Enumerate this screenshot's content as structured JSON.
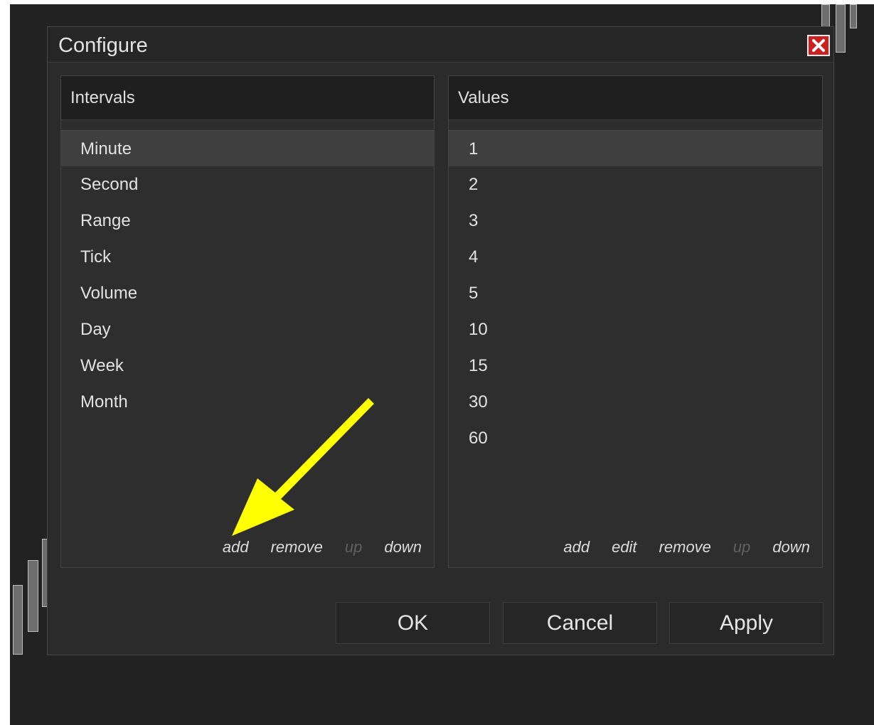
{
  "dialog": {
    "title": "Configure",
    "close_icon": "close-icon"
  },
  "intervals": {
    "header": "Intervals",
    "items": [
      "Minute",
      "Second",
      "Range",
      "Tick",
      "Volume",
      "Day",
      "Week",
      "Month"
    ],
    "selected": "Minute",
    "actions": {
      "add": "add",
      "remove": "remove",
      "up": "up",
      "down": "down"
    },
    "disabled_actions": [
      "up"
    ]
  },
  "values": {
    "header": "Values",
    "items": [
      "1",
      "2",
      "3",
      "4",
      "5",
      "10",
      "15",
      "30",
      "60"
    ],
    "selected": "1",
    "actions": {
      "add": "add",
      "edit": "edit",
      "remove": "remove",
      "up": "up",
      "down": "down"
    },
    "disabled_actions": [
      "up"
    ]
  },
  "buttons": {
    "ok": "OK",
    "cancel": "Cancel",
    "apply": "Apply"
  },
  "annotation": {
    "type": "arrow",
    "color": "#ffff00",
    "points_to": "add"
  },
  "colors": {
    "app_background": "#222222",
    "dialog_background": "#2b2b2b",
    "header_background": "#1f1f1f",
    "selected_row": "#3f3f3f",
    "close_button": "#cd1f1f",
    "disabled_text": "#606060"
  }
}
